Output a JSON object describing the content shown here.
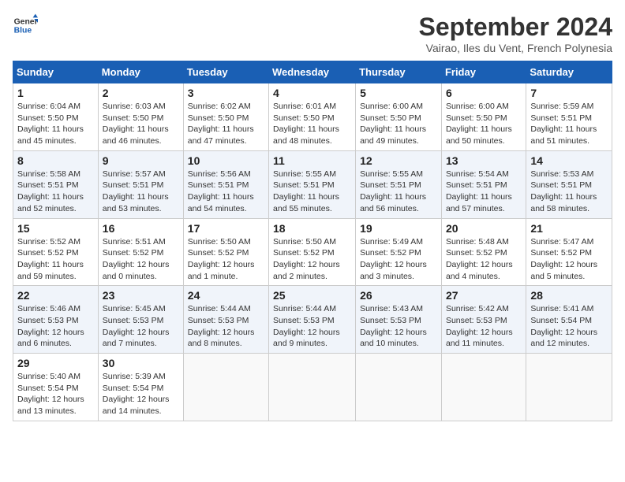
{
  "header": {
    "logo_line1": "General",
    "logo_line2": "Blue",
    "month_title": "September 2024",
    "subtitle": "Vairao, Iles du Vent, French Polynesia"
  },
  "weekdays": [
    "Sunday",
    "Monday",
    "Tuesday",
    "Wednesday",
    "Thursday",
    "Friday",
    "Saturday"
  ],
  "weeks": [
    [
      {
        "day": 1,
        "info": "Sunrise: 6:04 AM\nSunset: 5:50 PM\nDaylight: 11 hours\nand 45 minutes."
      },
      {
        "day": 2,
        "info": "Sunrise: 6:03 AM\nSunset: 5:50 PM\nDaylight: 11 hours\nand 46 minutes."
      },
      {
        "day": 3,
        "info": "Sunrise: 6:02 AM\nSunset: 5:50 PM\nDaylight: 11 hours\nand 47 minutes."
      },
      {
        "day": 4,
        "info": "Sunrise: 6:01 AM\nSunset: 5:50 PM\nDaylight: 11 hours\nand 48 minutes."
      },
      {
        "day": 5,
        "info": "Sunrise: 6:00 AM\nSunset: 5:50 PM\nDaylight: 11 hours\nand 49 minutes."
      },
      {
        "day": 6,
        "info": "Sunrise: 6:00 AM\nSunset: 5:50 PM\nDaylight: 11 hours\nand 50 minutes."
      },
      {
        "day": 7,
        "info": "Sunrise: 5:59 AM\nSunset: 5:51 PM\nDaylight: 11 hours\nand 51 minutes."
      }
    ],
    [
      {
        "day": 8,
        "info": "Sunrise: 5:58 AM\nSunset: 5:51 PM\nDaylight: 11 hours\nand 52 minutes."
      },
      {
        "day": 9,
        "info": "Sunrise: 5:57 AM\nSunset: 5:51 PM\nDaylight: 11 hours\nand 53 minutes."
      },
      {
        "day": 10,
        "info": "Sunrise: 5:56 AM\nSunset: 5:51 PM\nDaylight: 11 hours\nand 54 minutes."
      },
      {
        "day": 11,
        "info": "Sunrise: 5:55 AM\nSunset: 5:51 PM\nDaylight: 11 hours\nand 55 minutes."
      },
      {
        "day": 12,
        "info": "Sunrise: 5:55 AM\nSunset: 5:51 PM\nDaylight: 11 hours\nand 56 minutes."
      },
      {
        "day": 13,
        "info": "Sunrise: 5:54 AM\nSunset: 5:51 PM\nDaylight: 11 hours\nand 57 minutes."
      },
      {
        "day": 14,
        "info": "Sunrise: 5:53 AM\nSunset: 5:51 PM\nDaylight: 11 hours\nand 58 minutes."
      }
    ],
    [
      {
        "day": 15,
        "info": "Sunrise: 5:52 AM\nSunset: 5:52 PM\nDaylight: 11 hours\nand 59 minutes."
      },
      {
        "day": 16,
        "info": "Sunrise: 5:51 AM\nSunset: 5:52 PM\nDaylight: 12 hours\nand 0 minutes."
      },
      {
        "day": 17,
        "info": "Sunrise: 5:50 AM\nSunset: 5:52 PM\nDaylight: 12 hours\nand 1 minute."
      },
      {
        "day": 18,
        "info": "Sunrise: 5:50 AM\nSunset: 5:52 PM\nDaylight: 12 hours\nand 2 minutes."
      },
      {
        "day": 19,
        "info": "Sunrise: 5:49 AM\nSunset: 5:52 PM\nDaylight: 12 hours\nand 3 minutes."
      },
      {
        "day": 20,
        "info": "Sunrise: 5:48 AM\nSunset: 5:52 PM\nDaylight: 12 hours\nand 4 minutes."
      },
      {
        "day": 21,
        "info": "Sunrise: 5:47 AM\nSunset: 5:52 PM\nDaylight: 12 hours\nand 5 minutes."
      }
    ],
    [
      {
        "day": 22,
        "info": "Sunrise: 5:46 AM\nSunset: 5:53 PM\nDaylight: 12 hours\nand 6 minutes."
      },
      {
        "day": 23,
        "info": "Sunrise: 5:45 AM\nSunset: 5:53 PM\nDaylight: 12 hours\nand 7 minutes."
      },
      {
        "day": 24,
        "info": "Sunrise: 5:44 AM\nSunset: 5:53 PM\nDaylight: 12 hours\nand 8 minutes."
      },
      {
        "day": 25,
        "info": "Sunrise: 5:44 AM\nSunset: 5:53 PM\nDaylight: 12 hours\nand 9 minutes."
      },
      {
        "day": 26,
        "info": "Sunrise: 5:43 AM\nSunset: 5:53 PM\nDaylight: 12 hours\nand 10 minutes."
      },
      {
        "day": 27,
        "info": "Sunrise: 5:42 AM\nSunset: 5:53 PM\nDaylight: 12 hours\nand 11 minutes."
      },
      {
        "day": 28,
        "info": "Sunrise: 5:41 AM\nSunset: 5:54 PM\nDaylight: 12 hours\nand 12 minutes."
      }
    ],
    [
      {
        "day": 29,
        "info": "Sunrise: 5:40 AM\nSunset: 5:54 PM\nDaylight: 12 hours\nand 13 minutes."
      },
      {
        "day": 30,
        "info": "Sunrise: 5:39 AM\nSunset: 5:54 PM\nDaylight: 12 hours\nand 14 minutes."
      },
      null,
      null,
      null,
      null,
      null
    ]
  ]
}
